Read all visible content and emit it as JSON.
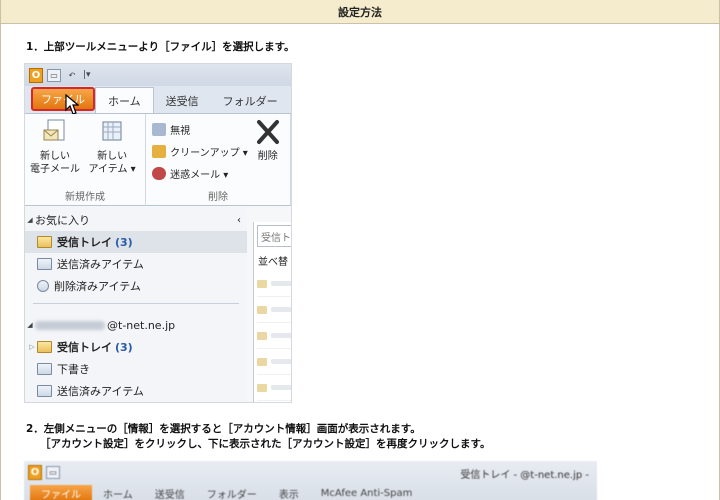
{
  "header": {
    "title": "設定方法"
  },
  "steps": {
    "step1": "1．上部ツールメニューより［ファイル］を選択します。",
    "step2_line1": "2．左側メニューの［情報］を選択すると［アカウント情報］画面が表示されます。",
    "step2_line2": "［アカウント設定］をクリックし、下に表示された［アカウント設定］を再度クリックします。"
  },
  "outlook": {
    "app_icon": "O",
    "tabs": [
      "ファイル",
      "ホーム",
      "送受信",
      "フォルダー"
    ],
    "ribbon": {
      "new_email": [
        "新しい",
        "電子メール"
      ],
      "new_items": [
        "新しい",
        "アイテム ▾"
      ],
      "ignore": "無視",
      "cleanup": "クリーンアップ ▾",
      "junk": "迷惑メール ▾",
      "delete": "削除",
      "group_new": "新規作成",
      "group_delete": "削除"
    },
    "nav": {
      "favorites": "お気に入り",
      "fav_inbox": "受信トレイ",
      "fav_inbox_count": "(3)",
      "fav_sent": "送信済みアイテム",
      "fav_deleted": "削除済みアイテム",
      "account_suffix": "@t-net.ne.jp",
      "acc_inbox": "受信トレイ",
      "acc_inbox_count": "(3)",
      "acc_drafts": "下書き",
      "acc_sent": "送信済みアイテム"
    },
    "list": {
      "search_placeholder": "受信ト",
      "sort_label": "並べ替"
    }
  },
  "outlook2": {
    "title": "受信トレイ - @t-net.ne.jp -",
    "tabs": [
      "ファイル",
      "ホーム",
      "送受信",
      "フォルダー",
      "表示",
      "McAfee Anti-Spam"
    ]
  },
  "icons": [
    "outlook-app-icon",
    "save-icon",
    "undo-icon",
    "mouse-pointer-icon",
    "new-email-icon",
    "new-items-icon",
    "ignore-icon",
    "cleanup-icon",
    "junk-icon",
    "delete-x-icon",
    "folder-icon",
    "sent-folder-icon",
    "trash-icon",
    "drafts-icon"
  ],
  "colors": {
    "header_bg": "#f4eccc",
    "file_tab": "#e2760d",
    "highlight_border": "#d8272b",
    "count_blue": "#2a5aa8"
  }
}
